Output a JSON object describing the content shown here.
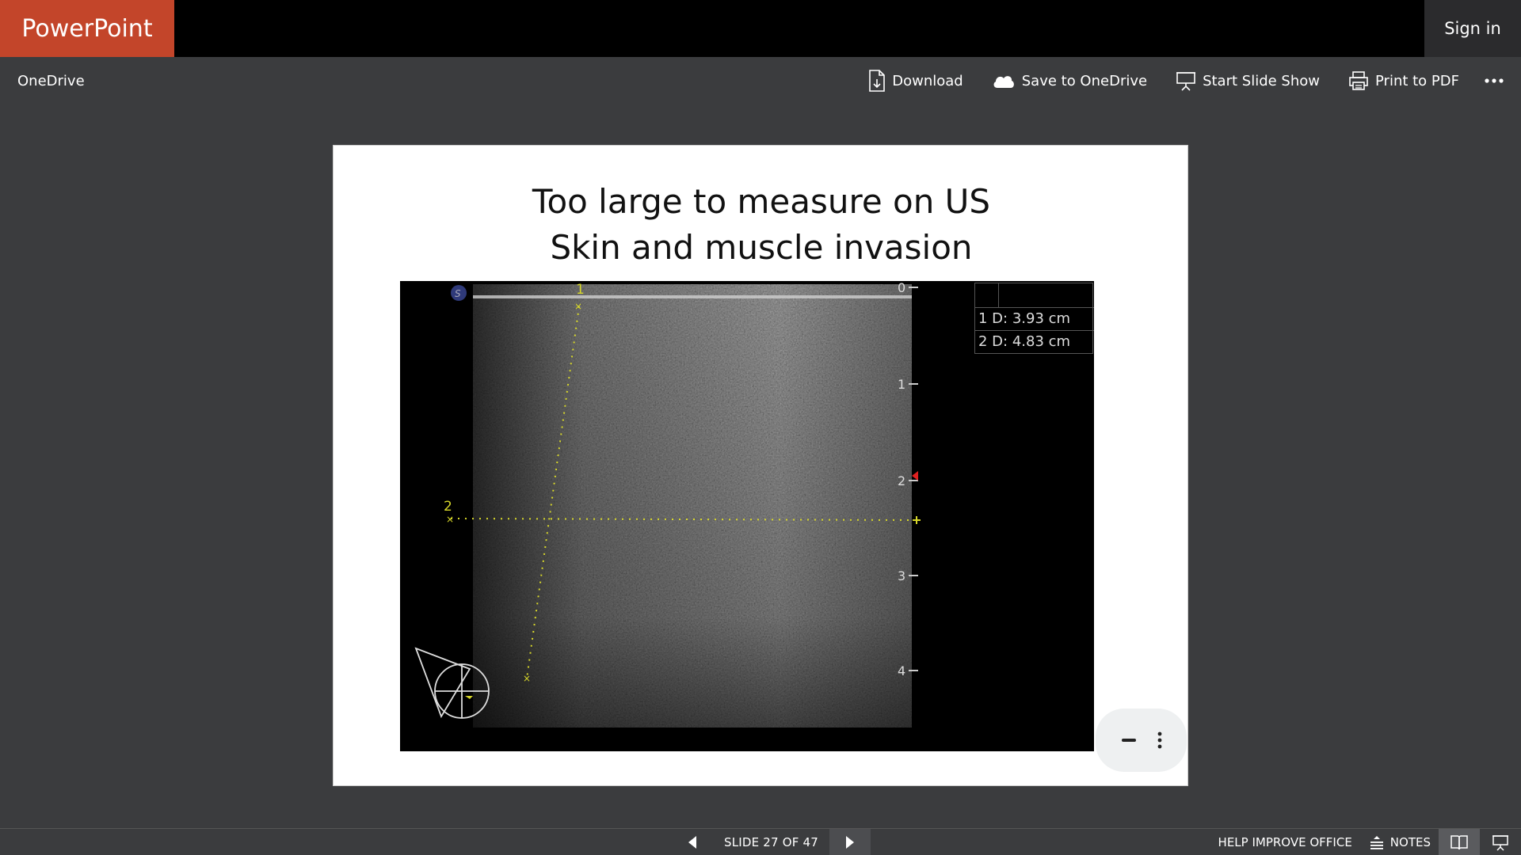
{
  "app": {
    "brand": "PowerPoint",
    "sign_in": "Sign in"
  },
  "commandbar": {
    "location": "OneDrive",
    "download": "Download",
    "save_to_onedrive": "Save to OneDrive",
    "start_slide_show": "Start Slide Show",
    "print_to_pdf": "Print to PDF",
    "more_icon": "ellipsis-icon"
  },
  "slide": {
    "title_line1": "Too large to measure on US",
    "title_line2": "Skin and muscle invasion",
    "ultrasound": {
      "measurements": [
        {
          "label": "1  D: 3.93   cm"
        },
        {
          "label": "2  D: 4.83   cm"
        }
      ],
      "depth_ticks": [
        "0",
        "1",
        "2",
        "3",
        "4"
      ],
      "caliper_labels": [
        "1",
        "2"
      ],
      "caliper_color": "#d8d82a",
      "marker_color": "#e02020"
    }
  },
  "statusbar": {
    "slide_counter": "SLIDE 27 OF 47",
    "help_improve": "HELP IMPROVE OFFICE",
    "notes": "NOTES"
  },
  "colors": {
    "brand": "#c3452a",
    "topbar": "#000000",
    "chrome": "#3b3c3e"
  }
}
